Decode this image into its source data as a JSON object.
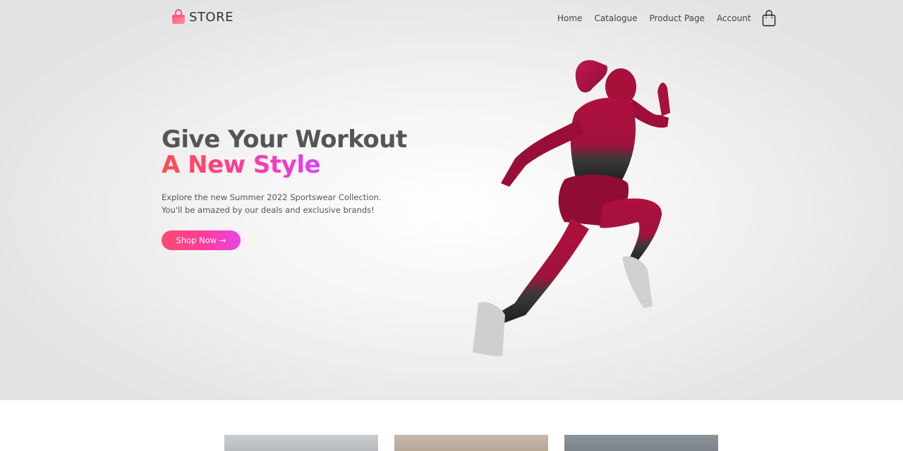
{
  "brand": {
    "name": "STORE",
    "logo_icon": "shopping-bag-icon",
    "logo_colors": [
      "#ff4d6d",
      "#ff8aa0"
    ]
  },
  "nav": {
    "items": [
      {
        "label": "Home"
      },
      {
        "label": "Catalogue"
      },
      {
        "label": "Product Page"
      },
      {
        "label": "Account"
      }
    ],
    "cart_icon": "cart-bag-icon"
  },
  "hero": {
    "headline_line1": "Give Your Workout",
    "headline_line2": "A New Style",
    "description_line1": "Explore the new Summer 2022 Sportswear Collection.",
    "description_line2": "You'll be amazed by our deals and exclusive brands!",
    "cta_label": "Shop Now →",
    "accent_gradient": [
      "#ff4d4d",
      "#ff3c8c",
      "#e040fb"
    ],
    "image": "woman-sprinter-image"
  },
  "products": [
    {
      "image": "product-thumbnail-1"
    },
    {
      "image": "product-thumbnail-2"
    },
    {
      "image": "product-thumbnail-3"
    }
  ]
}
